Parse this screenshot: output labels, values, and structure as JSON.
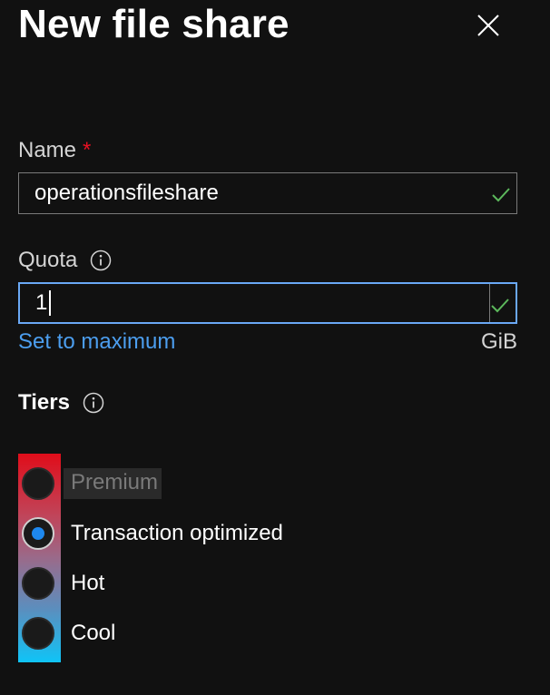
{
  "panel": {
    "title": "New file share",
    "close_icon": "close-icon"
  },
  "name_field": {
    "label": "Name",
    "required_marker": "*",
    "value": "operationsfileshare",
    "valid_icon": "check-icon"
  },
  "quota_field": {
    "label": "Quota",
    "info_icon": "info-icon",
    "value": "1",
    "valid_icon": "check-icon",
    "set_max_link": "Set to maximum",
    "unit": "GiB"
  },
  "tiers": {
    "title": "Tiers",
    "info_icon": "info-icon",
    "options": [
      {
        "label": "Premium",
        "selected": false,
        "disabled": true
      },
      {
        "label": "Transaction optimized",
        "selected": true,
        "disabled": false
      },
      {
        "label": "Hot",
        "selected": false,
        "disabled": false
      },
      {
        "label": "Cool",
        "selected": false,
        "disabled": false
      }
    ]
  },
  "colors": {
    "background": "#111111",
    "accent_link": "#4c9eef",
    "focus_border": "#6aa8f5",
    "radio_selected": "#1e88ef",
    "required": "#e81123",
    "valid_check": "#5cb85c"
  }
}
